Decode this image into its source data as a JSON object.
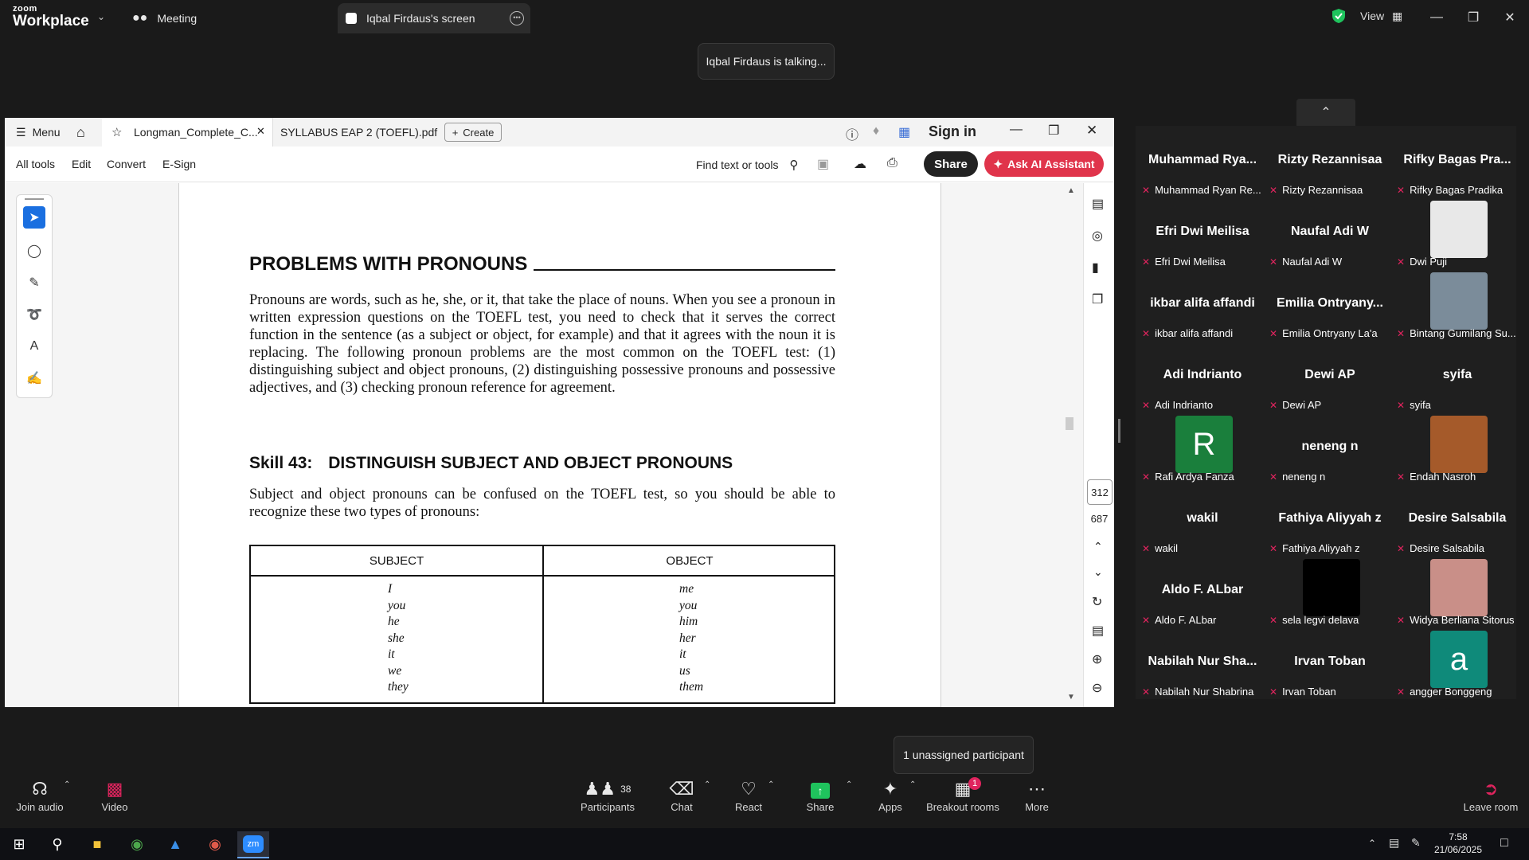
{
  "zoom": {
    "logo_line1": "zoom",
    "logo_line2": "Workplace",
    "meeting_tab": "Meeting",
    "share_tab": "Iqbal Firdaus's screen",
    "view_label": "View",
    "talking_toast": "Iqbal Firdaus is talking...",
    "unassigned_toast": "1 unassigned participant"
  },
  "acrobat": {
    "menu_label": "Menu",
    "tabs": [
      "Longman_Complete_C...",
      "SYLLABUS EAP 2 (TOEFL).pdf"
    ],
    "create_label": "Create",
    "sign_in": "Sign in",
    "tools": [
      "All tools",
      "Edit",
      "Convert",
      "E-Sign"
    ],
    "find_placeholder": "Find text or tools",
    "share_label": "Share",
    "ai_label": "Ask AI Assistant",
    "page_number": "312",
    "page_total": "687"
  },
  "document": {
    "heading": "PROBLEMS WITH PRONOUNS",
    "paragraph1": "Pronouns are words, such as he, she, or it, that take the place of nouns. When you see a pronoun in written expression questions on the TOEFL test, you need to check that it serves the correct function in the sentence (as a subject or object, for example) and that it agrees with the noun it is replacing. The following pronoun problems are the most common on the TOEFL test: (1) distinguishing subject and object pronouns, (2) distinguishing possessive pronouns and possessive adjectives, and (3) checking pronoun reference for agreement.",
    "skill_label": "Skill 43:",
    "skill_title": "DISTINGUISH SUBJECT AND OBJECT PRONOUNS",
    "paragraph2": "Subject and object pronouns can be confused on the TOEFL test, so you should be able to recognize these two types of pronouns:",
    "table_headers": [
      "SUBJECT",
      "OBJECT"
    ],
    "subject_pronouns": [
      "I",
      "you",
      "he",
      "she",
      "it",
      "we",
      "they"
    ],
    "object_pronouns": [
      "me",
      "you",
      "him",
      "her",
      "it",
      "us",
      "them"
    ]
  },
  "participants": [
    {
      "name": "Muhammad Rya...",
      "label": "Muhammad Ryan Re..."
    },
    {
      "name": "Rizty Rezannisaa",
      "label": "Rizty Rezannisaa"
    },
    {
      "name": "Rifky Bagas Pra...",
      "label": "Rifky Bagas Pradika"
    },
    {
      "name": "Efri Dwi Meilisa",
      "label": "Efri Dwi Meilisa"
    },
    {
      "name": "Naufal Adi W",
      "label": "Naufal Adi W"
    },
    {
      "name": "",
      "label": "Dwi Puji"
    },
    {
      "name": "ikbar alifa affandi",
      "label": "ikbar alifa affandi"
    },
    {
      "name": "Emilia  Ontryany...",
      "label": "Emilia Ontryany La'a"
    },
    {
      "name": "",
      "label": "Bintang Gumilang Su..."
    },
    {
      "name": "Adi Indrianto",
      "label": "Adi Indrianto"
    },
    {
      "name": "Dewi AP",
      "label": "Dewi AP"
    },
    {
      "name": "syifa",
      "label": "syifa"
    },
    {
      "name": "",
      "label": "Rafi Ardya Fanza",
      "avatar": "R"
    },
    {
      "name": "neneng n",
      "label": "neneng n"
    },
    {
      "name": "",
      "label": "Endah Nasroh"
    },
    {
      "name": "wakil",
      "label": "wakil"
    },
    {
      "name": "Fathiya Aliyyah z",
      "label": "Fathiya Aliyyah z"
    },
    {
      "name": "Desire Salsabila",
      "label": "Desire Salsabila"
    },
    {
      "name": "Aldo F. ALbar",
      "label": "Aldo F. ALbar"
    },
    {
      "name": "",
      "label": "sela legvi delava"
    },
    {
      "name": "",
      "label": "Widya Berliana Sitorus"
    },
    {
      "name": "Nabilah Nur Sha...",
      "label": "Nabilah Nur Shabrina"
    },
    {
      "name": "Irvan Toban",
      "label": "Irvan Toban"
    },
    {
      "name": "",
      "label": "angger Bonggeng",
      "avatar": "a"
    }
  ],
  "toolbar": {
    "join_audio": "Join audio",
    "video": "Video",
    "participants": "Participants",
    "participants_count": "38",
    "chat": "Chat",
    "react": "React",
    "share": "Share",
    "apps": "Apps",
    "breakout": "Breakout rooms",
    "breakout_badge": "1",
    "more": "More",
    "leave": "Leave room"
  },
  "taskbar": {
    "time": "7:58",
    "date": "21/06/2025"
  },
  "colors": {
    "acrobat_red": "#e0344b",
    "zoom_share_green": "#1fc35d",
    "mic_muted": "#e0245e",
    "avatar_green": "#1a7f3c",
    "avatar_teal": "#0f8a7a"
  }
}
